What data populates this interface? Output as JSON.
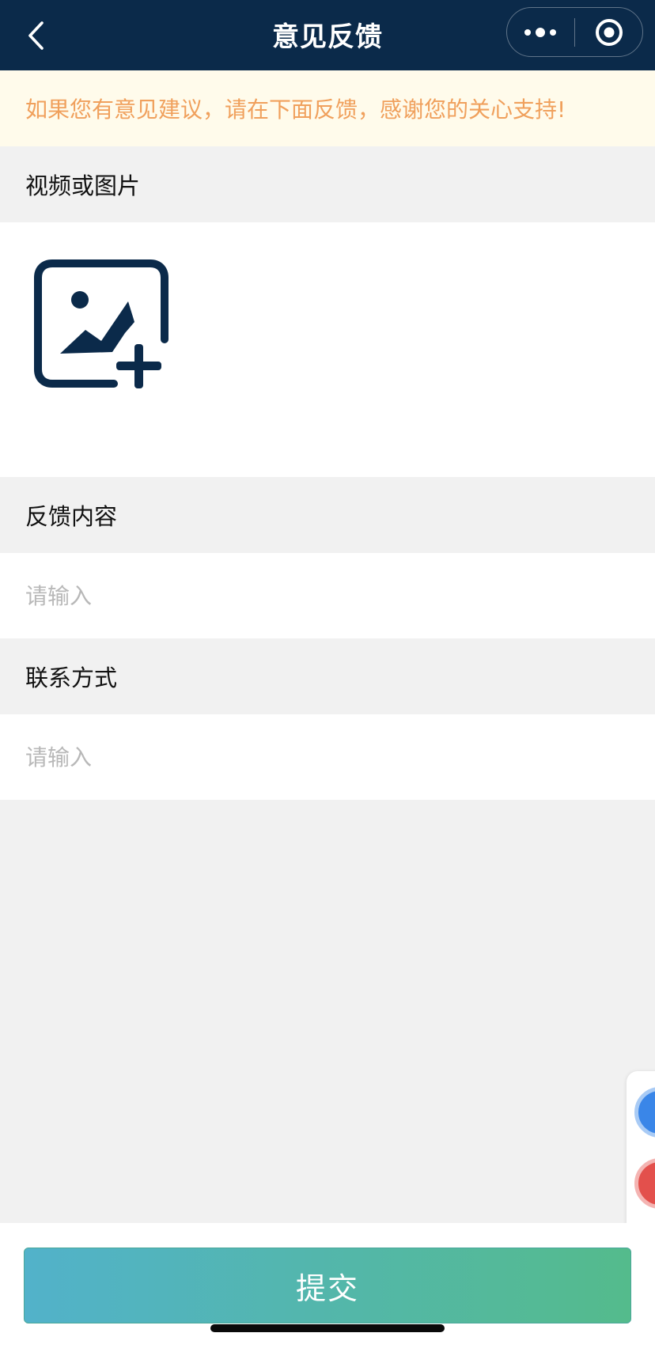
{
  "navbar": {
    "title": "意见反馈",
    "back_icon": "chevron-left-icon",
    "more_icon": "more-dots-icon",
    "close_icon": "target-circle-icon"
  },
  "notice": {
    "text": "如果您有意见建议，请在下面反馈，感谢您的关心支持!"
  },
  "media_section": {
    "label": "视频或图片",
    "upload_icon": "add-image-icon"
  },
  "content_section": {
    "label": "反馈内容",
    "placeholder": "请输入",
    "value": ""
  },
  "contact_section": {
    "label": "联系方式",
    "placeholder": "请输入",
    "value": ""
  },
  "submit": {
    "label": "提交"
  },
  "colors": {
    "navbar_bg": "#0b2a4a",
    "notice_bg": "#fffbeb",
    "notice_text": "#f0a05c",
    "accent": "#0b2a4a",
    "button_gradient_start": "#52b2ca",
    "button_gradient_end": "#54bb8c"
  }
}
